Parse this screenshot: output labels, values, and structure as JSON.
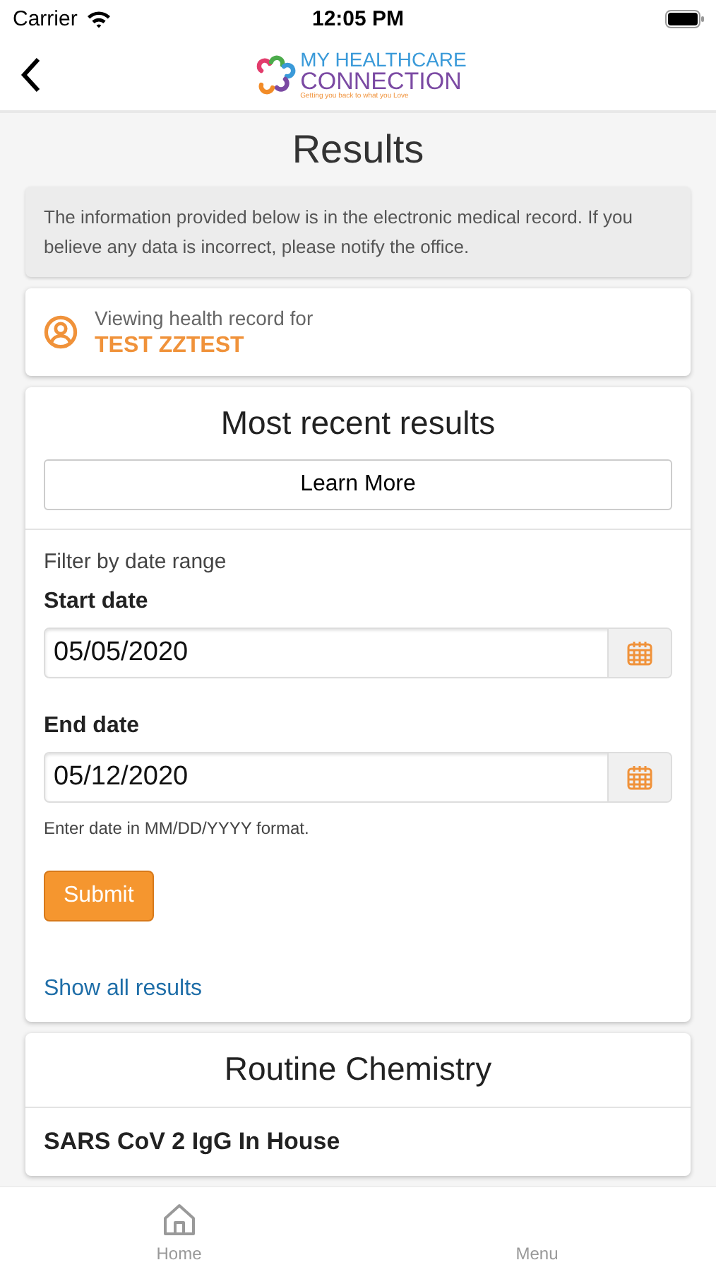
{
  "status_bar": {
    "carrier": "Carrier",
    "time": "12:05 PM"
  },
  "header": {
    "logo_line_1": "MY HEALTHCARE",
    "logo_line_2": "CONNECTION",
    "logo_tagline": "Getting you back to what you Love"
  },
  "page_title": "Results",
  "notice": "The information provided below is in the electronic medical record. If you believe any data is incorrect, please notify the office.",
  "patient": {
    "caption": "Viewing health record for",
    "name": "TEST ZZTEST"
  },
  "results_card": {
    "title": "Most recent results",
    "learn_more": "Learn More",
    "filter_label": "Filter by date range",
    "fields": [
      {
        "label": "Start date",
        "value": "05/05/2020"
      },
      {
        "label": "End date",
        "value": "05/12/2020"
      }
    ],
    "hint": "Enter date in MM/DD/YYYY format.",
    "submit": "Submit",
    "show_all": "Show all results"
  },
  "section": {
    "title": "Routine Chemistry",
    "first_test": "SARS CoV 2 IgG In House"
  },
  "tab_bar": [
    {
      "label": "Home",
      "kind": "home"
    },
    {
      "label": "Menu",
      "kind": "menu"
    }
  ]
}
